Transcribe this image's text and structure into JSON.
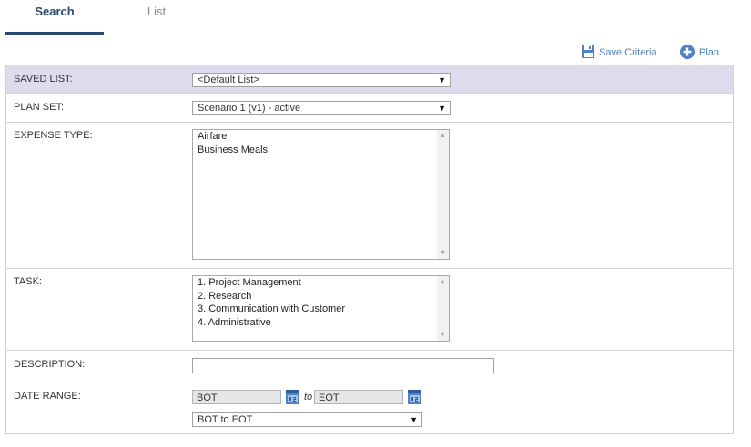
{
  "tabs": [
    {
      "label": "Search",
      "active": true
    },
    {
      "label": "List",
      "active": false
    }
  ],
  "toolbar": {
    "save_criteria_label": "Save Criteria",
    "plan_label": "Plan",
    "icon_color": "#4f82c3"
  },
  "form": {
    "saved_list": {
      "label": "SAVED LIST:",
      "value": "<Default List>"
    },
    "plan_set": {
      "label": "PLAN SET:",
      "value": "Scenario 1 (v1) - active"
    },
    "expense_type": {
      "label": "EXPENSE TYPE:",
      "options": [
        "Airfare",
        "Business Meals"
      ]
    },
    "task": {
      "label": "TASK:",
      "options": [
        "1. Project Management",
        "2. Research",
        "3. Communication with Customer",
        "4. Administrative"
      ]
    },
    "description": {
      "label": "DESCRIPTION:",
      "value": ""
    },
    "date_range": {
      "label": "DATE RANGE:",
      "from": "BOT",
      "to_word": "to",
      "to": "EOT",
      "preset": "BOT to EOT"
    }
  },
  "colors": {
    "tab_active": "#2b4a70",
    "row_shaded": "#dcdced"
  }
}
